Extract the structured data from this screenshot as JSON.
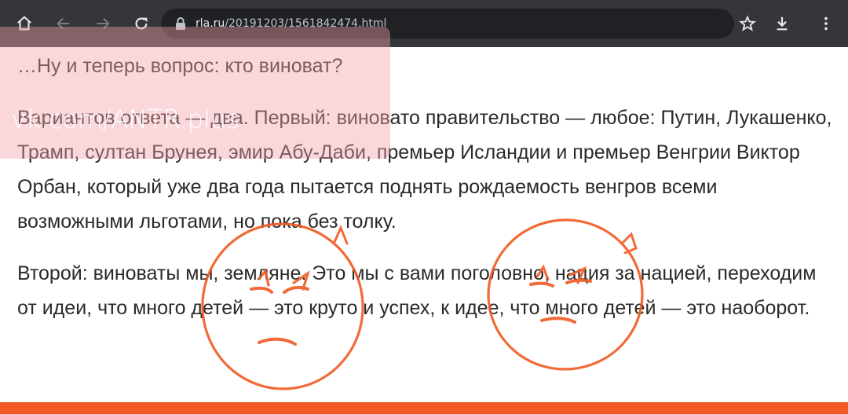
{
  "browser": {
    "url_host": "rla.ru",
    "url_path": "/20191203/1561842474.html",
    "icons": [
      "home-icon",
      "back-icon",
      "forward-icon",
      "reload-icon",
      "lock-icon",
      "star-icon",
      "download-icon",
      "menu-icon"
    ],
    "toolbar_color": "#35363a"
  },
  "watermark": {
    "text": "vk.com/ANTR.plus"
  },
  "article": {
    "paragraphs": [
      "…Ну и теперь вопрос: кто виноват?",
      "Вариантов ответа — два. Первый: виновато правительство — любое: Путин, Лукашенко, Трамп, султан Брунея, эмир Абу-Даби, премьер Исландии и премьер Венгрии Виктор Орбан, который уже два года пытается поднять рождаемость венгров всеми возможными льготами, но пока без толку.",
      "Второй: виноваты мы, земляне. Это мы с вами поголовно, нация за нацией, переходим от идеи, что много детей — это круто и успех, к идее, что много детей — это наоборот."
    ]
  },
  "decor": {
    "accent_color": "#f15a22"
  }
}
